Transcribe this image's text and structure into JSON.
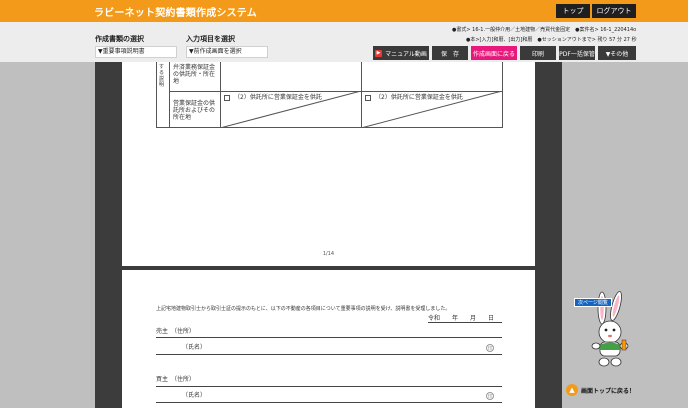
{
  "header": {
    "app_title": "ラビーネット契約書類作成システム",
    "top_label": "トップ",
    "logout_label": "ログアウト"
  },
  "controls": {
    "doc_select_title": "作成書類の選択",
    "doc_select_value": "▼重要事項説明書",
    "item_select_title": "入力項目を選択",
    "item_select_value": "▼前作成画面を選択",
    "info_line1": "●書式> 16-1.一般仲介用／土地建物／売買代金固定　●案件名> 16-1_220414o",
    "info_line2": "●本>[入力]和暦、[出力]和暦　●セッションアウトまで> 残り 57 分 27 秒",
    "manual_label": "マニュアル動画",
    "save_label": "保　存",
    "back_create_label": "作成画面に戻る",
    "print_label": "印刷",
    "pdf_label": "PDF一括保管",
    "other_label": "▼その他"
  },
  "document": {
    "side_label_top": "する説明",
    "row1_label": "弁済業務保証金の供託所・所在地",
    "row2_label": "営業保証金の供託所およびその所在地",
    "check_label_left": "（2）供託所に営業保証金を供託",
    "check_label_right": "（2）供託所に営業保証金を供託",
    "page_number": "1/14",
    "statement": "上記宅地建物取引士から取引士証の提示のもとに、以下の不動産の各項目について重要事項の説明を受け、説明書を受理しました。",
    "date_label": "令和　　年　　月　　日",
    "seller_label": "売主　（住所）",
    "seller_name": "（氏名）",
    "buyer_label": "買主　（住所）",
    "buyer_name": "（氏名）",
    "seal_char": "印"
  },
  "sidebar": {
    "next_page_label": "次ページ閲覧",
    "back_to_top_label": "画面トップに戻る！"
  },
  "colors": {
    "orange": "#f39a1b",
    "pink": "#e8197d",
    "dark": "#1f1f1f",
    "blue": "#1565c0"
  }
}
